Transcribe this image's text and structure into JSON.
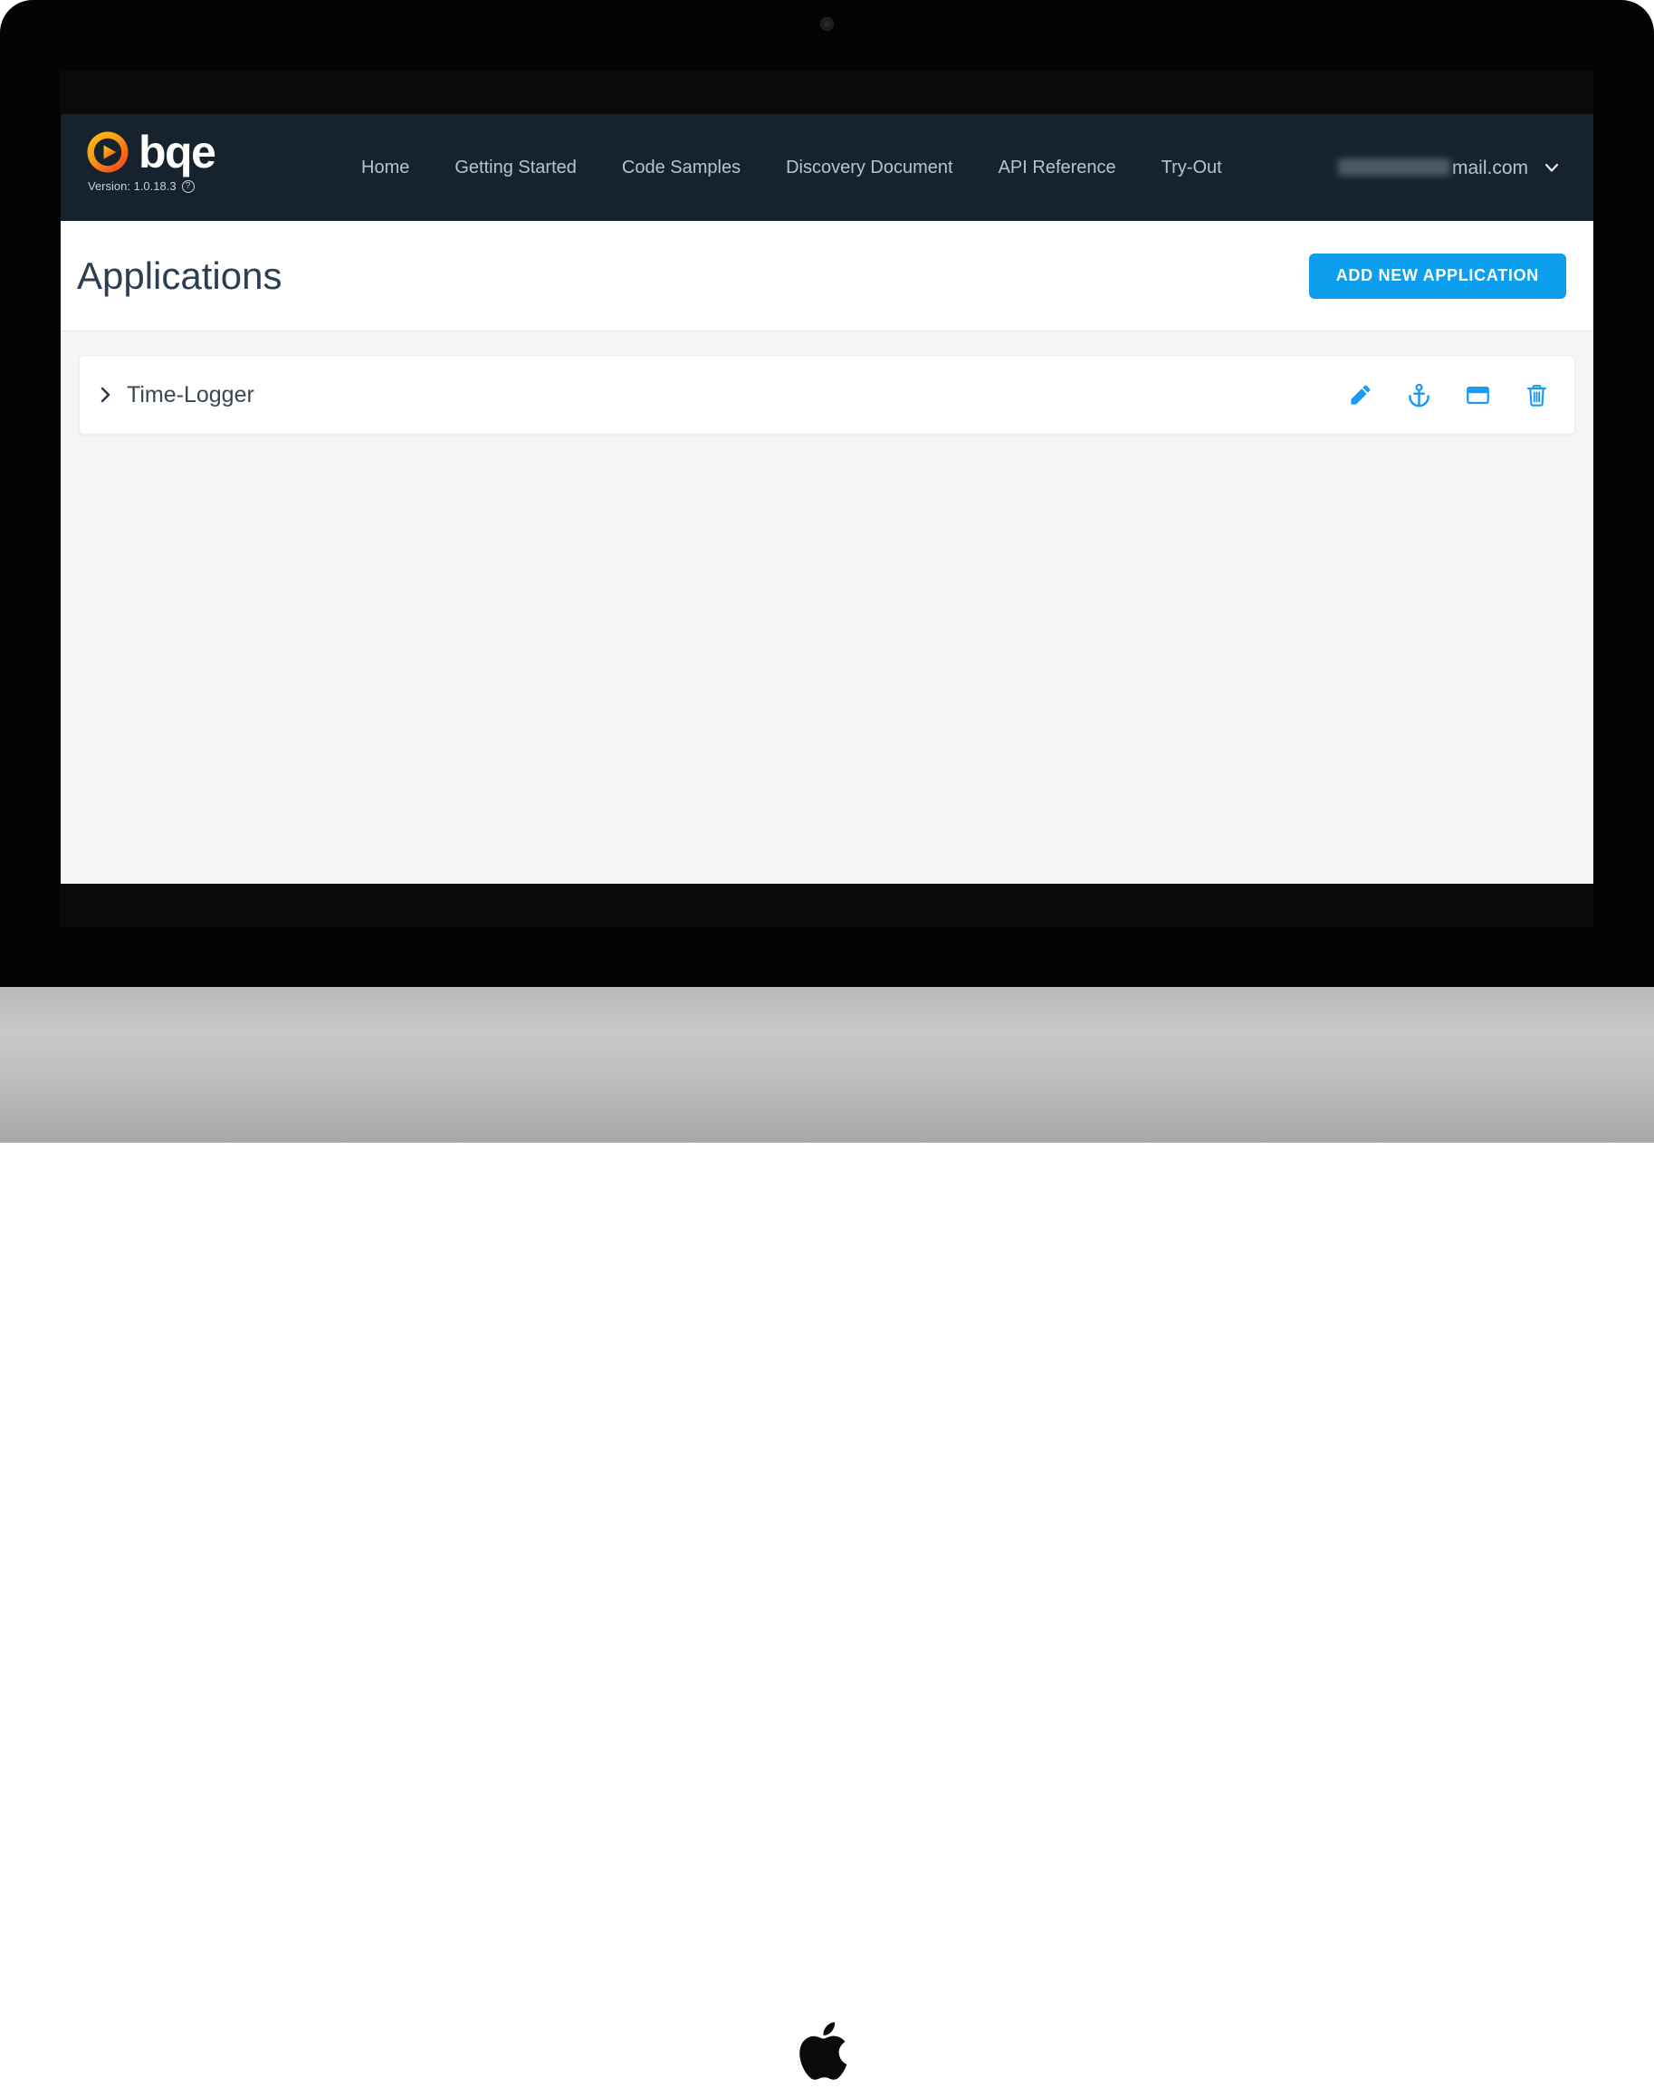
{
  "device": {
    "type": "imac-desktop",
    "webcam": "webcam-dot",
    "base_logo": "apple-logo"
  },
  "navbar": {
    "brand": {
      "logo": "bqe-play-logo",
      "wordmark": "bqe",
      "version_label": "Version: 1.0.18.3",
      "help_glyph": "?"
    },
    "links": [
      {
        "label": "Home"
      },
      {
        "label": "Getting Started"
      },
      {
        "label": "Code Samples"
      },
      {
        "label": "Discovery Document"
      },
      {
        "label": "API Reference"
      },
      {
        "label": "Try-Out"
      }
    ],
    "account": {
      "email_visible": "mail.com",
      "email_redacted": true,
      "caret_icon": "chevron-down-icon"
    },
    "background_color": "#16232e"
  },
  "header": {
    "title": "Applications",
    "add_button_label": "ADD NEW APPLICATION",
    "accent_color": "#0d9fee"
  },
  "applications": {
    "items": [
      {
        "name": "Time-Logger",
        "expanded": false,
        "expand_icon": "chevron-right-icon",
        "actions": [
          {
            "name": "edit-application",
            "icon": "pencil-icon"
          },
          {
            "name": "anchor-application",
            "icon": "anchor-icon"
          },
          {
            "name": "open-application-window",
            "icon": "browser-window-icon"
          },
          {
            "name": "delete-application",
            "icon": "trash-icon"
          }
        ]
      }
    ]
  }
}
